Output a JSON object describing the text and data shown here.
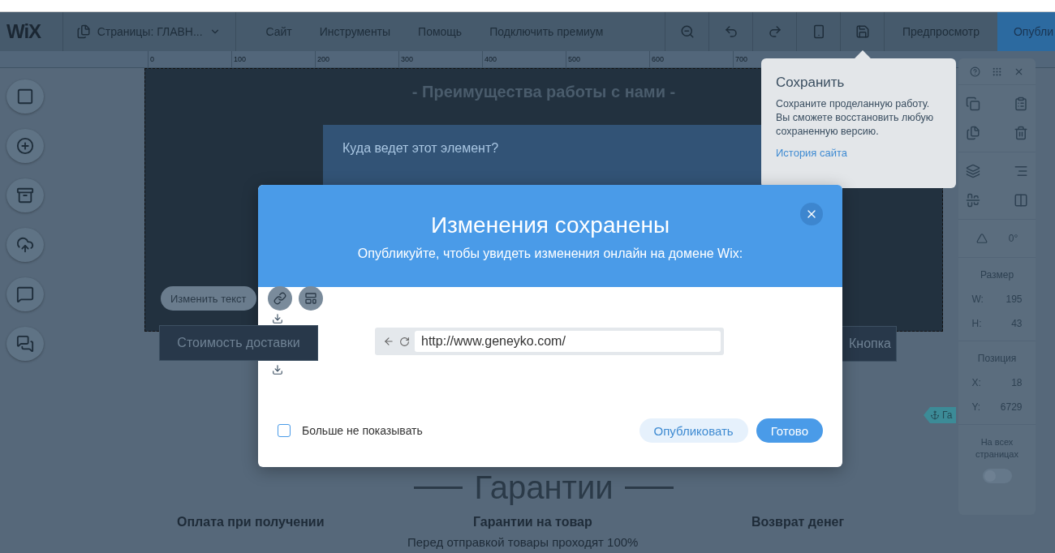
{
  "topbar": {
    "logo": "WiX",
    "pages": "Страницы: ГЛАВН...",
    "menu": [
      "Сайт",
      "Инструменты",
      "Помощь",
      "Подключить премиум"
    ],
    "preview": "Предпросмотр",
    "publish": "Опубли"
  },
  "ruler": {
    "ticks": [
      "0",
      "100",
      "200",
      "300",
      "400",
      "500",
      "600",
      "700"
    ]
  },
  "canvas": {
    "heading": "- Преимущества работы с нами -",
    "text_toolbar": "Изменить текст",
    "selected_button": "Стоимость доставки",
    "other_button": "Кнопка",
    "section_title": "Гарантии",
    "features": [
      "Оплата при получении",
      "Гарантии на товар",
      "Возврат денег"
    ],
    "feature_text": "Перед отправкой товары проходят 100%",
    "anchor": "Га"
  },
  "link_dialog": {
    "title": "Куда ведет этот элемент?"
  },
  "tooltip": {
    "title": "Сохранить",
    "text": "Сохраните проделанную работу. Вы сможете восстановить любую сохраненную версию.",
    "link": "История сайта"
  },
  "modal": {
    "title": "Изменения сохранены",
    "subtitle": "Опубликуйте, чтобы увидеть изменения онлайн на домене Wix:",
    "url": "http://www.geneyko.com/",
    "checkbox": {
      "label": "Больше не показывать",
      "checked": false
    },
    "buttons": [
      {
        "label": "Опубликовать",
        "kind": "secondary"
      },
      {
        "label": "Готово",
        "kind": "primary"
      }
    ]
  },
  "panel": {
    "angle": "0°",
    "size_title": "Размер",
    "size": [
      {
        "label": "W:",
        "value": "195"
      },
      {
        "label": "H:",
        "value": "43"
      }
    ],
    "position_title": "Позиция",
    "position": [
      {
        "label": "X:",
        "value": "18"
      },
      {
        "label": "Y:",
        "value": "6729"
      }
    ],
    "all_pages": "На всех страницах",
    "all_pages_on": false
  }
}
